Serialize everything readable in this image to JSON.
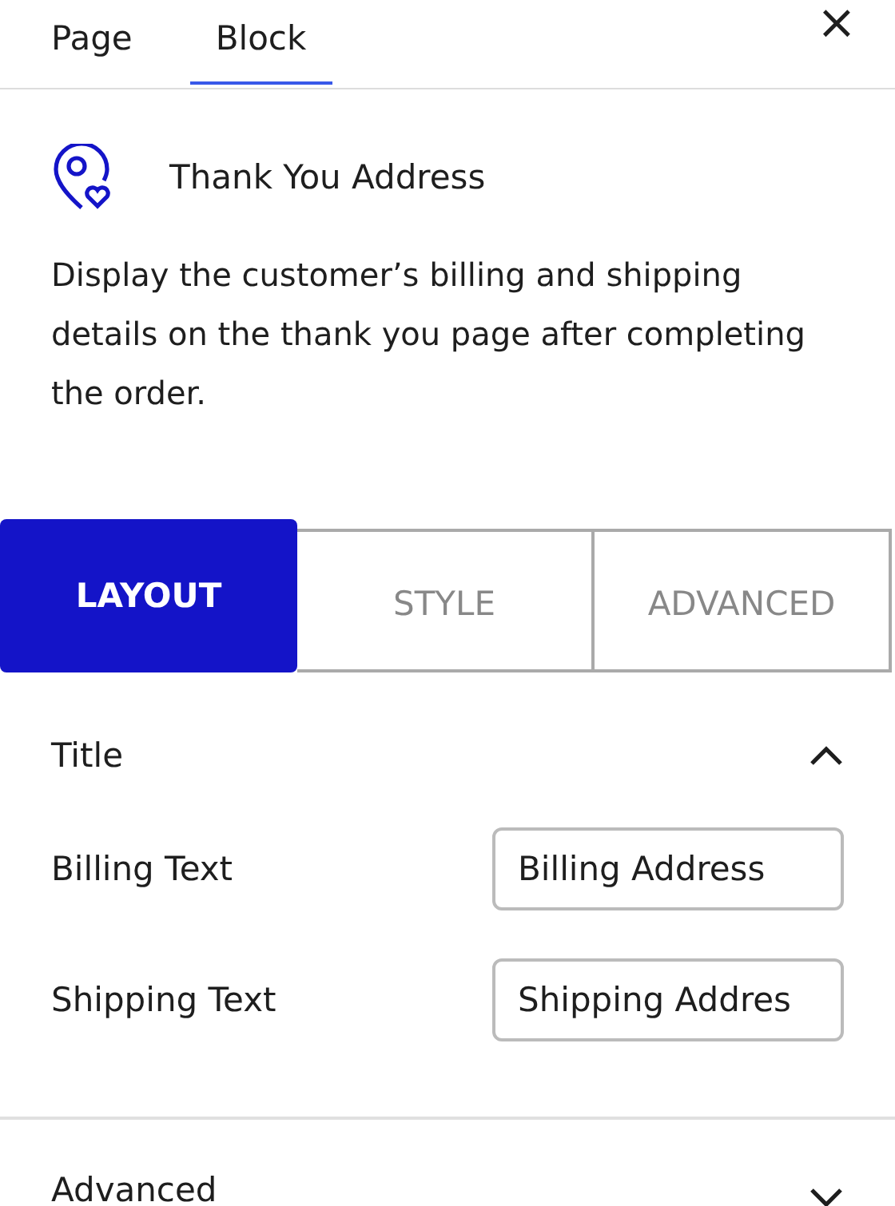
{
  "sidebar_tabs": [
    {
      "label": "Page",
      "selected": false
    },
    {
      "label": "Block",
      "selected": true
    }
  ],
  "close": "×",
  "block": {
    "title": "Thank You Address",
    "description": "Display the customer’s billing and shipping details on the thank you page after completing the order."
  },
  "settings_tabs": [
    {
      "label": "LAYOUT",
      "selected": true
    },
    {
      "label": "STYLE",
      "selected": false
    },
    {
      "label": "ADVANCED",
      "selected": false
    }
  ],
  "panels": [
    {
      "title": "Title",
      "expanded": true,
      "fields": [
        {
          "label": "Billing Text",
          "value": "Billing Address"
        },
        {
          "label": "Shipping Text",
          "value": "Shipping Addres"
        }
      ]
    },
    {
      "title": "Advanced",
      "expanded": false
    }
  ]
}
